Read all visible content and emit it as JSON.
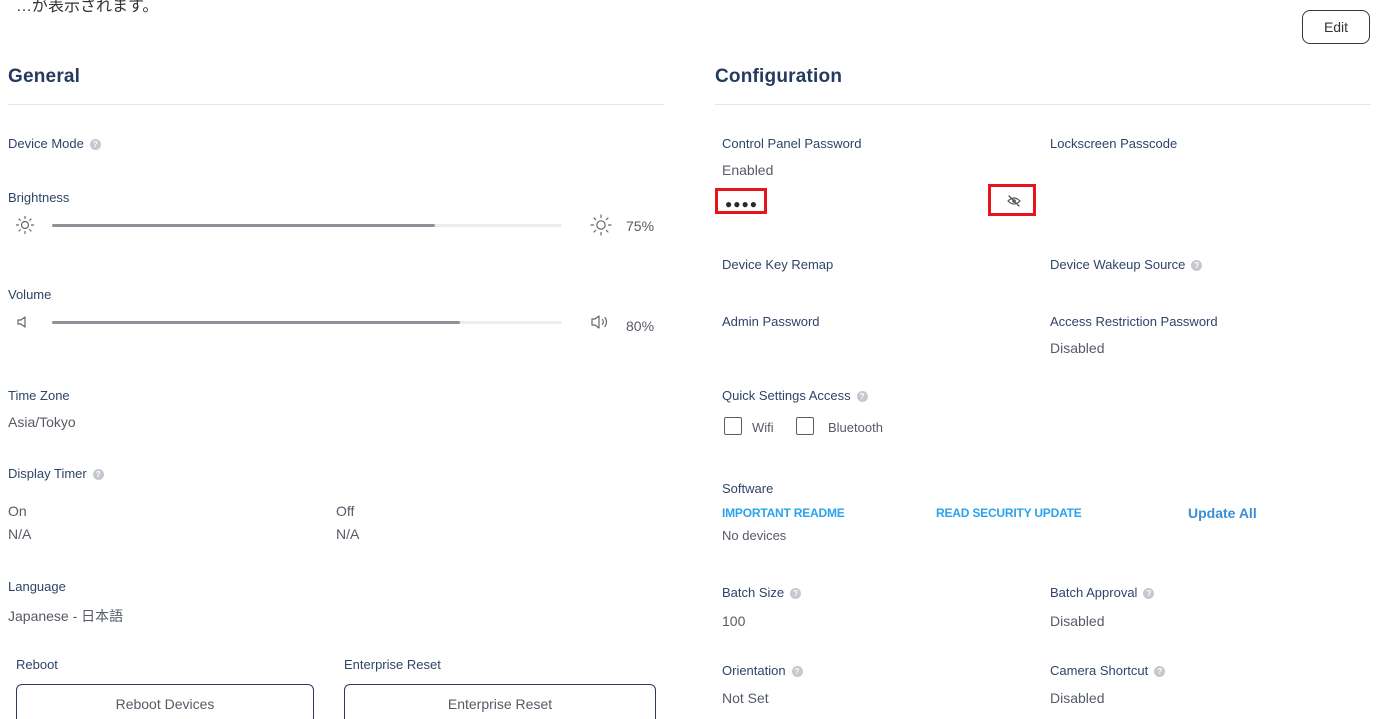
{
  "top_cut_text": "…が表示されます。",
  "edit_label": "Edit",
  "general": {
    "title": "General",
    "device_mode_label": "Device Mode",
    "brightness": {
      "label": "Brightness",
      "percent": 75,
      "percent_text": "75%"
    },
    "volume": {
      "label": "Volume",
      "percent": 80,
      "percent_text": "80%"
    },
    "time_zone": {
      "label": "Time Zone",
      "value": "Asia/Tokyo"
    },
    "display_timer": {
      "label": "Display Timer",
      "on_label": "On",
      "on_value": "N/A",
      "off_label": "Off",
      "off_value": "N/A"
    },
    "language": {
      "label": "Language",
      "value": "Japanese - 日本語"
    },
    "reboot": {
      "label": "Reboot",
      "button": "Reboot Devices"
    },
    "enterprise_reset": {
      "label": "Enterprise Reset",
      "button": "Enterprise Reset"
    }
  },
  "configuration": {
    "title": "Configuration",
    "control_panel_password": {
      "label": "Control Panel Password",
      "value": "Enabled",
      "masked": "●●●●"
    },
    "lockscreen_passcode": {
      "label": "Lockscreen Passcode"
    },
    "device_key_remap": {
      "label": "Device Key Remap"
    },
    "device_wakeup_source": {
      "label": "Device Wakeup Source"
    },
    "admin_password": {
      "label": "Admin Password"
    },
    "access_restriction_password": {
      "label": "Access Restriction Password",
      "value": "Disabled"
    },
    "quick_settings_access": {
      "label": "Quick Settings Access",
      "wifi": "Wifi",
      "bluetooth": "Bluetooth"
    },
    "software": {
      "label": "Software",
      "important_readme": "IMPORTANT README",
      "read_security_update": "READ SECURITY UPDATE",
      "update_all": "Update All",
      "status": "No devices"
    },
    "batch_size": {
      "label": "Batch Size",
      "value": "100"
    },
    "batch_approval": {
      "label": "Batch Approval",
      "value": "Disabled"
    },
    "orientation": {
      "label": "Orientation",
      "value": "Not Set"
    },
    "camera_shortcut": {
      "label": "Camera Shortcut",
      "value": "Disabled"
    }
  },
  "colors": {
    "title": "#253a5e",
    "link": "#29a3ee",
    "highlight": "#e8141d",
    "slider_fill": "#8d9299"
  }
}
